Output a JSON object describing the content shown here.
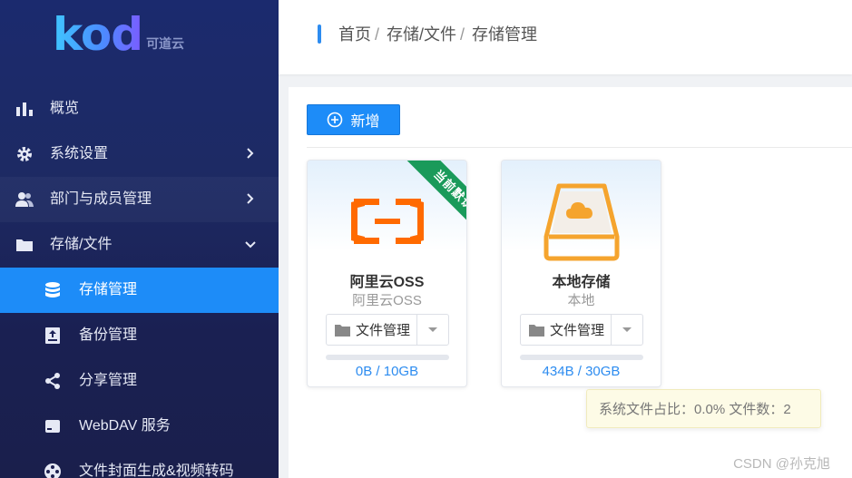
{
  "logo": {
    "text": "kod",
    "sub": "可道云"
  },
  "sidebar": {
    "items": [
      {
        "label": "概览",
        "icon": "bar-chart-icon",
        "arrow": "none"
      },
      {
        "label": "系统设置",
        "icon": "gear-icon",
        "arrow": "right"
      },
      {
        "label": "部门与成员管理",
        "icon": "users-icon",
        "arrow": "right"
      },
      {
        "label": "存储/文件",
        "icon": "folder-icon",
        "arrow": "down"
      },
      {
        "label": "存储管理",
        "icon": "database-icon",
        "active": true
      },
      {
        "label": "备份管理",
        "icon": "backup-icon"
      },
      {
        "label": "分享管理",
        "icon": "share-icon"
      },
      {
        "label": "WebDAV 服务",
        "icon": "drive-icon"
      },
      {
        "label": "文件封面生成&视频转码",
        "icon": "film-reel-icon"
      }
    ]
  },
  "breadcrumb": {
    "items": [
      "首页",
      "存储/文件",
      "存储管理"
    ],
    "separator": "/"
  },
  "toolbar": {
    "add_label": "新增"
  },
  "storages": [
    {
      "title": "阿里云OSS",
      "subtitle": "阿里云OSS",
      "action": "文件管理",
      "usage": "0B / 10GB",
      "used_fraction": 0,
      "badge": "当前默认",
      "icon": "aliyun-icon"
    },
    {
      "title": "本地存储",
      "subtitle": "本地",
      "action": "文件管理",
      "usage": "434B / 30GB",
      "used_fraction": 0.0,
      "icon": "local-disk-icon"
    }
  ],
  "tooltip": {
    "text": "系统文件占比：0.0% 文件数：2"
  },
  "watermark": "CSDN @孙克旭",
  "colors": {
    "primary": "#1d8cf8",
    "sidebar": "#1b2a6e",
    "badge": "#1a9a5a",
    "aliyun": "#ff6a00",
    "local": "#f5a42e"
  }
}
